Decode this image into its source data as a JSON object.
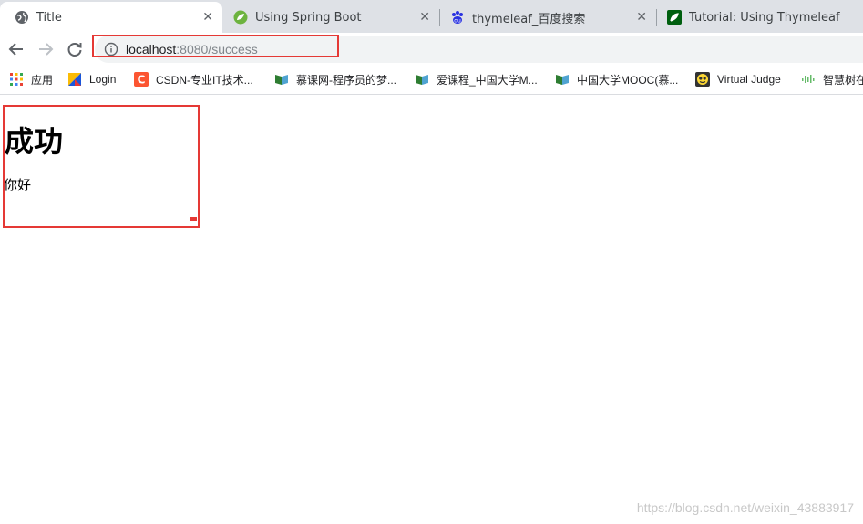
{
  "tabs": [
    {
      "title": "Title",
      "active": true,
      "icon": "globe-icon"
    },
    {
      "title": "Using Spring Boot",
      "active": false,
      "icon": "spring-icon"
    },
    {
      "title": "thymeleaf_百度搜索",
      "active": false,
      "icon": "baidu-icon"
    },
    {
      "title": "Tutorial: Using Thymeleaf",
      "active": false,
      "icon": "thymeleaf-icon"
    }
  ],
  "address_bar": {
    "host": "localhost",
    "rest": ":8080/success"
  },
  "bookmarks": [
    {
      "label": "应用",
      "icon": "apps-grid-icon"
    },
    {
      "label": "Login",
      "icon": "login-icon"
    },
    {
      "label": "CSDN-专业IT技术...",
      "icon": "csdn-icon"
    },
    {
      "label": "慕课网-程序员的梦...",
      "icon": "book-icon"
    },
    {
      "label": "爱课程_中国大学M...",
      "icon": "book-icon"
    },
    {
      "label": "中国大学MOOC(慕...",
      "icon": "book-icon"
    },
    {
      "label": "Virtual Judge",
      "icon": "vjudge-icon"
    },
    {
      "label": "智慧树在",
      "icon": "audio-bars-icon"
    }
  ],
  "page": {
    "heading": "成功",
    "text": "你好"
  },
  "watermark": "https://blog.csdn.net/weixin_43883917",
  "colors": {
    "annotation_red": "#e53935",
    "tabstrip_bg": "#dee1e6",
    "omnibox_bg": "#f1f3f4"
  }
}
